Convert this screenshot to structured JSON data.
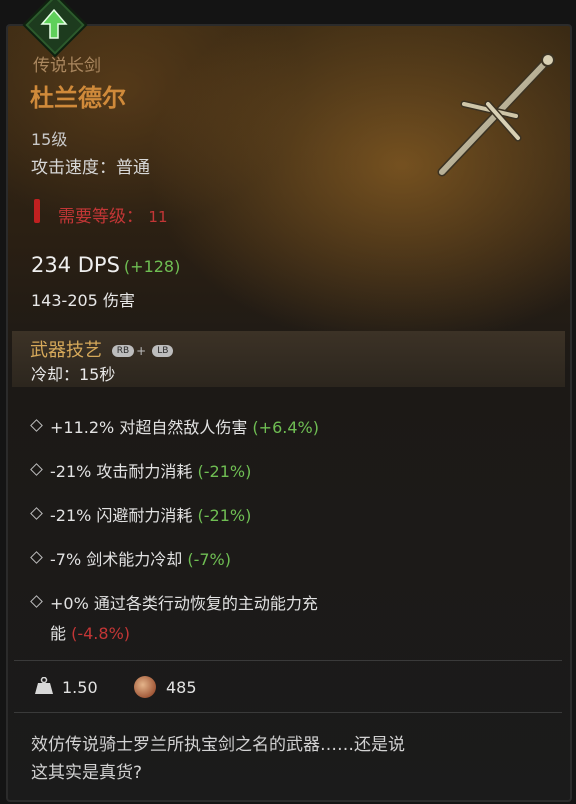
{
  "item": {
    "type": "传说长剑",
    "name": "杜兰德尔",
    "level": "15级",
    "speed": "攻击速度：普通",
    "requirement_label": "需要等级：",
    "requirement_value": "11"
  },
  "damage": {
    "dps": "234 DPS",
    "dps_diff": "(+128)",
    "range": "143-205 伤害"
  },
  "skill": {
    "title": "武器技艺",
    "button_1": "RB",
    "plus": "+",
    "button_2": "LB",
    "cooldown": "冷却：15秒"
  },
  "stats": [
    {
      "text": "+11.2% 对超自然敌人伤害",
      "diff": "(+6.4%)",
      "tone": "pos"
    },
    {
      "text": "-21% 攻击耐力消耗",
      "diff": "(-21%)",
      "tone": "pos"
    },
    {
      "text": "-21% 闪避耐力消耗",
      "diff": "(-21%)",
      "tone": "pos"
    },
    {
      "text": "-7% 剑术能力冷却",
      "diff": "(-7%)",
      "tone": "pos"
    },
    {
      "text": "+0% 通过各类行动恢复的主动能力充",
      "text_line2": "能",
      "diff": "(-4.8%)",
      "tone": "neg"
    }
  ],
  "footer": {
    "weight": "1.50",
    "gold": "485"
  },
  "description": "效仿传说骑士罗兰所执宝剑之名的武器……还是说这其实是真货?",
  "colors": {
    "legendary": "#d08a3a",
    "positive": "#6fbe53",
    "negative": "#c33636"
  },
  "icons": [
    "upgrade-arrow-icon",
    "sword-icon",
    "warning-icon",
    "weight-icon",
    "coin-icon"
  ]
}
